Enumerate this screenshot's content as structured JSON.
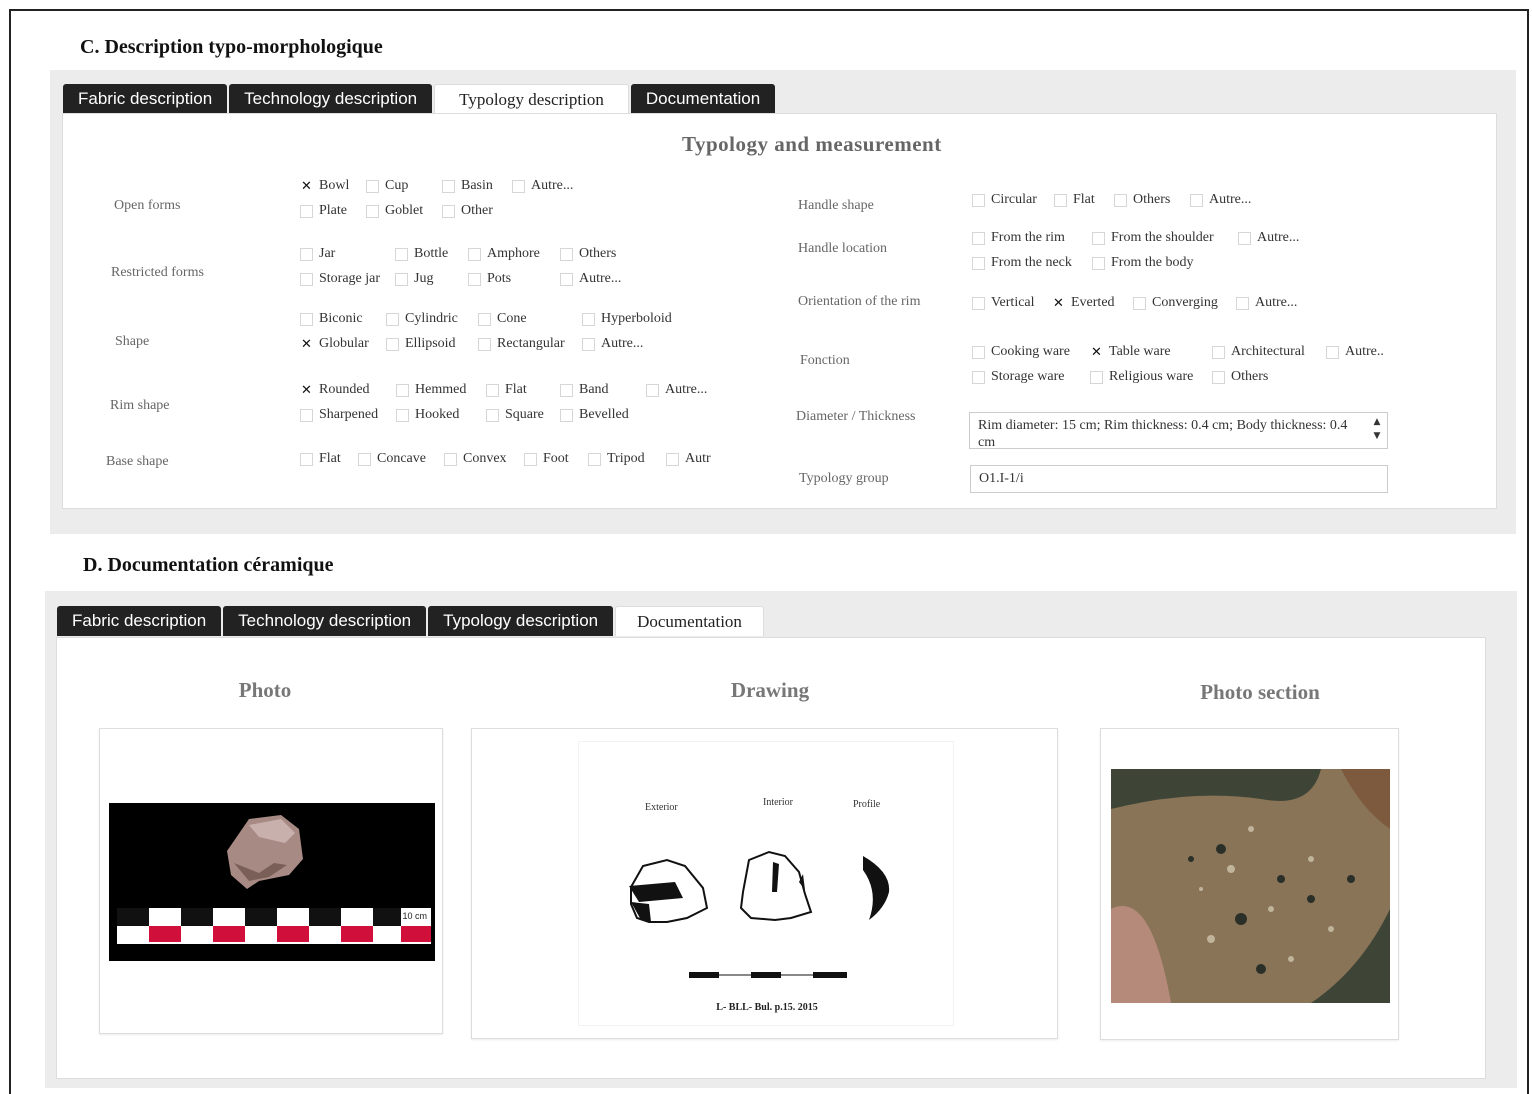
{
  "sectionC": {
    "title": "C. Description typo-morphologique",
    "tabs": [
      "Fabric description",
      "Technology description",
      "Typology description",
      "Documentation"
    ],
    "active_tab": 2,
    "panel_title": "Typology and measurement",
    "left": {
      "open_forms": {
        "label": "Open forms",
        "row1": [
          [
            "Bowl",
            true
          ],
          [
            "Cup",
            false
          ],
          [
            "Basin",
            false
          ],
          [
            "Autre...",
            false
          ]
        ],
        "row2": [
          [
            "Plate",
            false
          ],
          [
            "Goblet",
            false
          ],
          [
            "Other",
            false
          ]
        ]
      },
      "restricted_forms": {
        "label": "Restricted forms",
        "row1": [
          [
            "Jar",
            false
          ],
          [
            "Bottle",
            false
          ],
          [
            "Amphore",
            false
          ],
          [
            "Others",
            false
          ]
        ],
        "row2": [
          [
            "Storage jar",
            false
          ],
          [
            "Jug",
            false
          ],
          [
            "Pots",
            false
          ],
          [
            "Autre...",
            false
          ]
        ]
      },
      "shape": {
        "label": "Shape",
        "row1": [
          [
            "Biconic",
            false
          ],
          [
            "Cylindric",
            false
          ],
          [
            "Cone",
            false
          ],
          [
            "Hyperboloid",
            false
          ]
        ],
        "row2": [
          [
            "Globular",
            true
          ],
          [
            "Ellipsoid",
            false
          ],
          [
            "Rectangular",
            false
          ],
          [
            "Autre...",
            false
          ]
        ]
      },
      "rim_shape": {
        "label": "Rim shape",
        "row1": [
          [
            "Rounded",
            true
          ],
          [
            "Hemmed",
            false
          ],
          [
            "Flat",
            false
          ],
          [
            "Band",
            false
          ],
          [
            "Autre...",
            false
          ]
        ],
        "row2": [
          [
            "Sharpened",
            false
          ],
          [
            "Hooked",
            false
          ],
          [
            "Square",
            false
          ],
          [
            "Bevelled",
            false
          ]
        ]
      },
      "base_shape": {
        "label": "Base shape",
        "row1": [
          [
            "Flat",
            false
          ],
          [
            "Concave",
            false
          ],
          [
            "Convex",
            false
          ],
          [
            "Foot",
            false
          ],
          [
            "Tripod",
            false
          ],
          [
            "Autr",
            false
          ]
        ]
      }
    },
    "right": {
      "handle_shape": {
        "label": "Handle shape",
        "row1": [
          [
            "Circular",
            false
          ],
          [
            "Flat",
            false
          ],
          [
            "Others",
            false
          ],
          [
            "Autre...",
            false
          ]
        ]
      },
      "handle_location": {
        "label": "Handle location",
        "row1": [
          [
            "From the rim",
            false
          ],
          [
            "From the shoulder",
            false
          ],
          [
            "Autre...",
            false
          ]
        ],
        "row2": [
          [
            "From the neck",
            false
          ],
          [
            "From the body",
            false
          ]
        ]
      },
      "rim_orientation": {
        "label": "Orientation of the rim",
        "row1": [
          [
            "Vertical",
            false
          ],
          [
            "Everted",
            true
          ],
          [
            "Converging",
            false
          ],
          [
            "Autre...",
            false
          ]
        ]
      },
      "fonction": {
        "label": "Fonction",
        "row1": [
          [
            "Cooking ware",
            false
          ],
          [
            "Table ware",
            true
          ],
          [
            "Architectural",
            false
          ],
          [
            "Autre..",
            false
          ]
        ],
        "row2": [
          [
            "Storage ware",
            false
          ],
          [
            "Religious ware",
            false
          ],
          [
            "Others",
            false
          ]
        ]
      },
      "diameter": {
        "label": "Diameter / Thickness",
        "value": "Rim diameter: 15 cm; Rim thickness: 0.4 cm; Body thickness: 0.4 cm"
      },
      "typology_group": {
        "label": "Typology group",
        "value": "O1.I-1/i"
      }
    }
  },
  "sectionD": {
    "title": "D. Documentation céramique",
    "tabs": [
      "Fabric description",
      "Technology description",
      "Typology description",
      "Documentation"
    ],
    "active_tab": 3,
    "photo_title": "Photo",
    "drawing_title": "Drawing",
    "photo_section_title": "Photo section",
    "scale_label": "10 cm",
    "drawing_labels": {
      "exterior": "Exterior",
      "interior": "Interior",
      "profile": "Profile",
      "caption": "L- BLL- Bul. p.15. 2015"
    }
  },
  "icons": {
    "checked": "x-mark",
    "spinner": "up-down-arrows"
  }
}
